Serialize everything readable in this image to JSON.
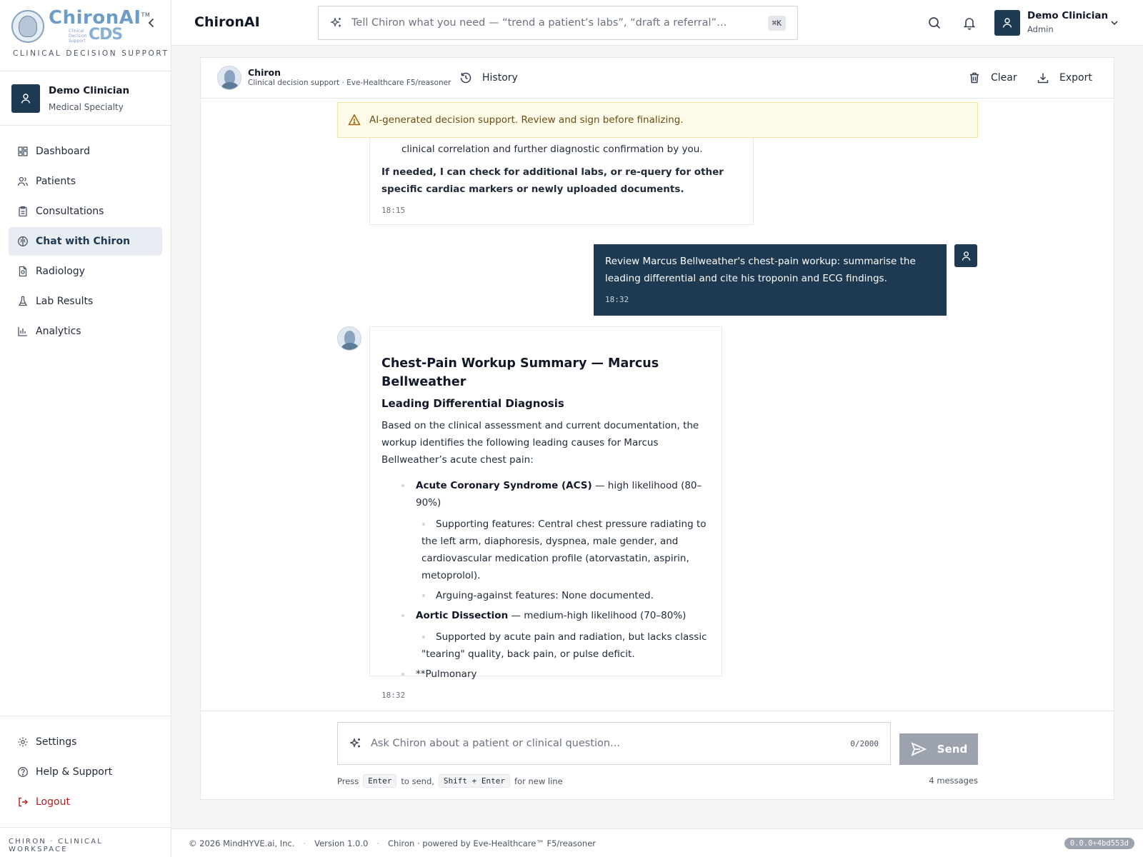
{
  "brand": {
    "name": "ChironAI",
    "trademark": "TM",
    "sub": "Clinical Decision Support",
    "cds": "CDS",
    "tagline": "CLINICAL DECISION SUPPORT"
  },
  "sidebar": {
    "user": {
      "name": "Demo Clinician",
      "role": "Medical Specialty"
    },
    "items": [
      {
        "label": "Dashboard",
        "icon": "dashboard-icon"
      },
      {
        "label": "Patients",
        "icon": "users-icon"
      },
      {
        "label": "Consultations",
        "icon": "clipboard-icon"
      },
      {
        "label": "Chat with Chiron",
        "icon": "brain-icon",
        "active": true
      },
      {
        "label": "Radiology",
        "icon": "scan-icon"
      },
      {
        "label": "Lab Results",
        "icon": "flask-icon"
      },
      {
        "label": "Analytics",
        "icon": "bar-chart-icon"
      }
    ],
    "bottom": [
      {
        "label": "Settings",
        "icon": "gear-icon"
      },
      {
        "label": "Help & Support",
        "icon": "help-icon"
      },
      {
        "label": "Logout",
        "icon": "logout-icon"
      }
    ],
    "footer": "CHIRON · CLINICAL WORKSPACE"
  },
  "topbar": {
    "title": "ChironAI",
    "command_placeholder": "Tell Chiron what you need — “trend a patient’s labs”, “draft a referral”…",
    "shortcut": "⌘K",
    "user": {
      "name": "Demo Clinician",
      "role": "Admin"
    }
  },
  "chat": {
    "header": {
      "name": "Chiron",
      "subtitle": "Clinical decision support · Eve-Healthcare F5/reasoner",
      "history": "History",
      "clear": "Clear",
      "export": "Export"
    },
    "warning": "AI-generated decision support. Review and sign before finalizing.",
    "messages": [
      {
        "role": "assistant",
        "line1": "clinical correlation and further diagnostic confirmation by you.",
        "line2": "If needed, I can check for additional labs, or re-query for other specific cardiac markers or newly uploaded documents.",
        "time": "18:15"
      },
      {
        "role": "user",
        "text": "Review Marcus Bellweather's chest-pain workup: summarise the leading differential and cite his troponin and ECG findings.",
        "time": "18:32"
      },
      {
        "role": "assistant",
        "heading": "Chest-Pain Workup Summary — Marcus Bellweather",
        "subheading": "Leading Differential Diagnosis",
        "intro": "Based on the clinical assessment and current documentation, the workup identifies the following leading causes for Marcus Bellweather’s acute chest pain:",
        "d1_name": "Acute Coronary Syndrome (ACS)",
        "d1_rest": " — high likelihood (80–90%)",
        "d1_sup": "Supporting features: Central chest pressure radiating to the left arm, diaphoresis, dyspnea, male gender, and cardiovascular medication profile (atorvastatin, aspirin, metoprolol).",
        "d1_against": "Arguing-against features: None documented.",
        "d2_name": "Aortic Dissection",
        "d2_rest": " — medium-high likelihood (70–80%)",
        "d2_sup": "Supported by acute pain and radiation, but lacks classic \"tearing\" quality, back pain, or pulse deficit.",
        "d3": "**Pulmonary",
        "time": "18:32"
      }
    ],
    "composer": {
      "placeholder": "Ask Chiron about a patient or clinical question...",
      "count": "0/2000",
      "send": "Send",
      "hint_press": "Press",
      "hint_enter": "Enter",
      "hint_to_send": "to send,",
      "hint_shift": "Shift + Enter",
      "hint_newline": "for new line",
      "message_count": "4 messages"
    }
  },
  "footer": {
    "copyright": "© 2026 MindHYVE.ai, Inc.",
    "version": "Version 1.0.0",
    "powered": "Chiron · powered by Eve-Healthcare™ F5/reasoner",
    "build": "0.0.0+4bd553d"
  }
}
